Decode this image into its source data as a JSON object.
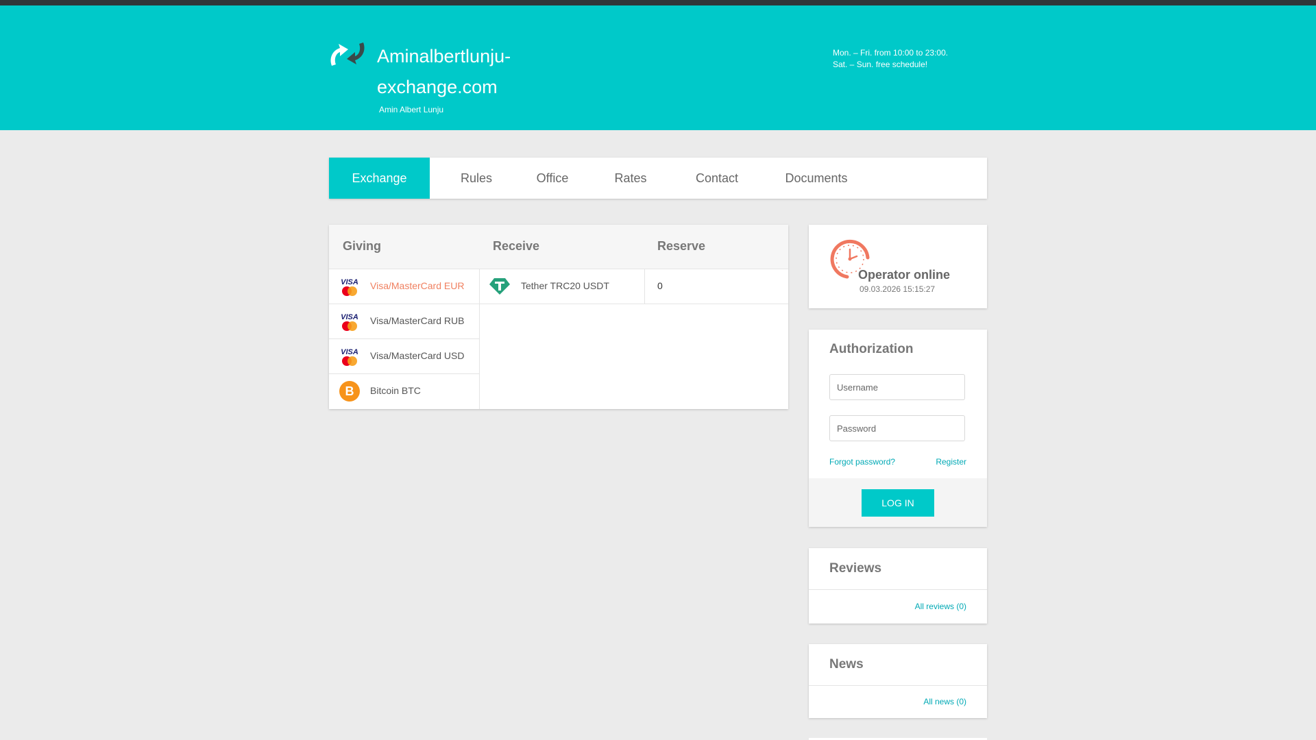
{
  "header": {
    "title_line1": "Aminalbertlunju-",
    "title_line2": "exchange.com",
    "subtitle": "Amin Albert Lunju",
    "schedule_line1": "Mon. – Fri. from 10:00 to 23:00.",
    "schedule_line2": "Sat. – Sun. free schedule!"
  },
  "nav": {
    "items": [
      {
        "label": "Exchange"
      },
      {
        "label": "Rules"
      },
      {
        "label": "Office"
      },
      {
        "label": "Rates"
      },
      {
        "label": "Contact"
      },
      {
        "label": "Documents"
      }
    ]
  },
  "exchange": {
    "col_giving": "Giving",
    "col_receive": "Receive",
    "col_reserve": "Reserve",
    "giving": [
      {
        "label": "Visa/MasterCard EUR"
      },
      {
        "label": "Visa/MasterCard RUB"
      },
      {
        "label": "Visa/MasterCard USD"
      },
      {
        "label": "Bitcoin BTC"
      }
    ],
    "receive": [
      {
        "label": "Tether TRC20 USDT",
        "reserve": "0"
      }
    ]
  },
  "operator": {
    "status": "Operator online",
    "datetime": "09.03.2026 15:15:27"
  },
  "auth": {
    "title": "Authorization",
    "username_placeholder": "Username",
    "password_placeholder": "Password",
    "forgot": "Forgot password?",
    "register": "Register",
    "login": "LOG IN"
  },
  "reviews": {
    "title": "Reviews",
    "all": "All reviews (0)"
  },
  "news": {
    "title": "News",
    "all": "All news (0)"
  },
  "colors": {
    "accent": "#00c9c9",
    "selected_text": "#f08060",
    "link": "#00a9b5"
  },
  "icons": {
    "logo": "exchange-arrows-icon",
    "card": "visa-mastercard-icon",
    "bitcoin": "bitcoin-icon",
    "tether": "tether-icon",
    "clock": "clock-icon"
  }
}
